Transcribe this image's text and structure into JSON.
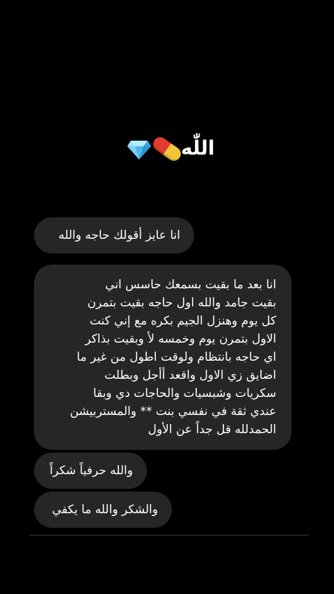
{
  "header": {
    "title": "اللّٰه",
    "emoji": [
      "pill-emoji",
      "gem-emoji"
    ]
  },
  "messages": [
    {
      "text": "انا عايز أقولك حاجه والله"
    },
    {
      "lines": [
        "انا بعد ما بقيت بسمعك حاسس اني",
        "بقيت جامد والله اول حاجه بقيت بتمرن",
        "كل يوم وهنزل الجيم بكره مع إني كنت",
        "الاول بتمرن يوم وخمسه لأ وبقيت بذاكر",
        "اي حاجه بانتظام ولوقت اطول من غير ما",
        "اضايق زي الاول واقعد أأجل وبطلت",
        "سكريات وشبسيات والحاجات دي وبقا",
        "عندي ثقة في نفسي بنت ** والمستربيشن",
        "الحمدلله قل جداً عن الأول"
      ]
    },
    {
      "text": "والله حرفياً شكراً"
    },
    {
      "text": "والشكر والله ما يكفي"
    }
  ],
  "colors": {
    "background": "#000000",
    "bubble": "#262626",
    "text": "#ffffff"
  }
}
